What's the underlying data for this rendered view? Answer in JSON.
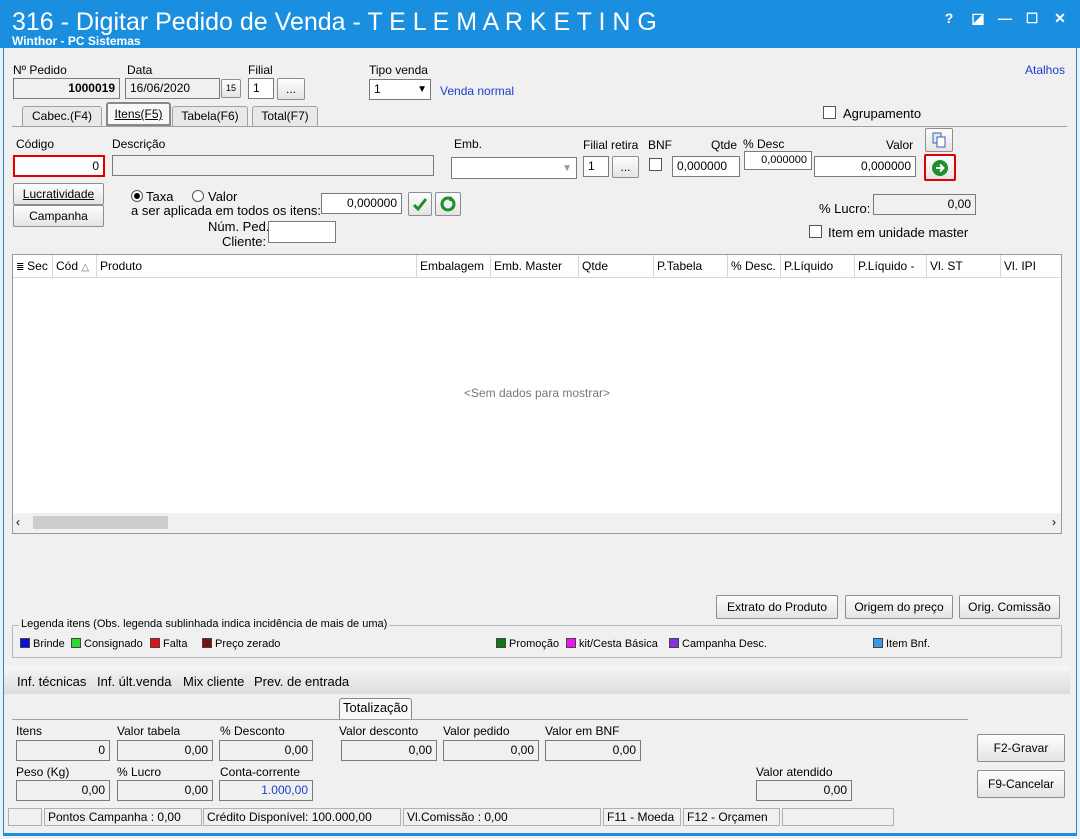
{
  "window": {
    "title": "316 - Digitar Pedido de Venda - T E L E M A R K E T I N G",
    "subtitle": "Winthor - PC Sistemas",
    "help_label": "?",
    "restore_label": "◪",
    "minimize_label": "—",
    "maximize_label": "☐",
    "close_label": "✕"
  },
  "header": {
    "pedido_label": "Nº Pedido",
    "pedido_value": "1000019",
    "data_label": "Data",
    "data_value": "16/06/2020",
    "calendar_label": "15",
    "filial_label": "Filial",
    "filial_value": "1",
    "ellipsis_label": "...",
    "tipo_venda_label": "Tipo venda",
    "tipo_venda_value": "1",
    "tipo_venda_desc": "Venda normal",
    "atalhos_label": "Atalhos"
  },
  "tabs": [
    {
      "label": "Cabec.(F4)"
    },
    {
      "label": "Itens(F5)"
    },
    {
      "label": "Tabela(F6)"
    },
    {
      "label": "Total(F7)"
    }
  ],
  "item_form": {
    "agrupamento_label": "Agrupamento",
    "codigo_label": "Código",
    "codigo_value": "0",
    "descricao_label": "Descrição",
    "descricao_value": "",
    "emb_label": "Emb.",
    "filial_retira_label": "Filial retira",
    "filial_retira_value": "1",
    "bnf_label": "BNF",
    "qtde_label": "Qtde",
    "qtde_value": "0,000000",
    "desc_label": "% Desc",
    "desc_value": "0,000000",
    "valor_label": "Valor",
    "valor_value": "0,000000",
    "lucratividade_label": "Lucratividade",
    "campanha_label": "Campanha",
    "taxa_label": "Taxa",
    "valor_radio_label": "Valor",
    "aplicada_label": "a ser aplicada em todos os itens:",
    "aplicada_value": "0,000000",
    "num_ped_label_1": "Núm. Ped.",
    "num_ped_label_2": "Cliente:",
    "num_ped_value": "",
    "lucro_label": "% Lucro:",
    "lucro_value": "0,00",
    "unidade_master_label": "Item em unidade master"
  },
  "grid": {
    "columns": [
      "Sec",
      "Cód",
      "Produto",
      "Embalagem",
      "Emb. Master",
      "Qtde",
      "P.Tabela",
      "% Desc.",
      "P.Líquido",
      "P.Líquido -",
      "Vl. ST",
      "Vl. IPI"
    ],
    "empty_text": "<Sem dados para mostrar>"
  },
  "actions": {
    "extrato_label": "Extrato do Produto",
    "origem_label": "Origem do preço",
    "comissao_label": "Orig. Comissão"
  },
  "legend": {
    "title": "Legenda itens (Obs. legenda sublinhada indica incidência de mais de uma)",
    "items": [
      {
        "label": "Brinde",
        "color": "#0a10d8"
      },
      {
        "label": "Consignado",
        "color": "#2ed82e"
      },
      {
        "label": "Falta",
        "color": "#e01414"
      },
      {
        "label": "Preço zerado",
        "color": "#7a1010"
      },
      {
        "label": "Promoção",
        "color": "#107a10"
      },
      {
        "label": "kit/Cesta Básica",
        "color": "#f014f0"
      },
      {
        "label": "Campanha Desc.",
        "color": "#8a2ee0"
      },
      {
        "label": "Item Bnf.",
        "color": "#3a9ae8"
      }
    ]
  },
  "info_tabs": [
    "Inf. técnicas",
    "Inf. últ.venda",
    "Mix cliente",
    "Prev. de entrada"
  ],
  "totals": {
    "tab_label": "Totalização",
    "itens_label": "Itens",
    "itens_value": "0",
    "valor_tabela_label": "Valor tabela",
    "valor_tabela_value": "0,00",
    "pct_desconto_label": "% Desconto",
    "pct_desconto_value": "0,00",
    "valor_desconto_label": "Valor desconto",
    "valor_desconto_value": "0,00",
    "valor_pedido_label": "Valor pedido",
    "valor_pedido_value": "0,00",
    "valor_bnf_label": "Valor em BNF",
    "valor_bnf_value": "0,00",
    "peso_label": "Peso (Kg)",
    "peso_value": "0,00",
    "pct_lucro_label": "% Lucro",
    "pct_lucro_value": "0,00",
    "conta_corrente_label": "Conta-corrente",
    "conta_corrente_value": "1.000,00",
    "valor_atendido_label": "Valor atendido",
    "valor_atendido_value": "0,00",
    "gravar_label": "F2-Gravar",
    "cancelar_label": "F9-Cancelar"
  },
  "status_bar": {
    "pontos": "Pontos Campanha : 0,00",
    "credito": "Crédito Disponível: 100.000,00",
    "comissao": "Vl.Comissão : 0,00",
    "f11": "F11 - Moeda",
    "f12": "F12 - Orçamen"
  },
  "colors": {
    "titlebar": "#1a8fe0",
    "highlight": "#e00000",
    "link": "#1a3fd0"
  }
}
